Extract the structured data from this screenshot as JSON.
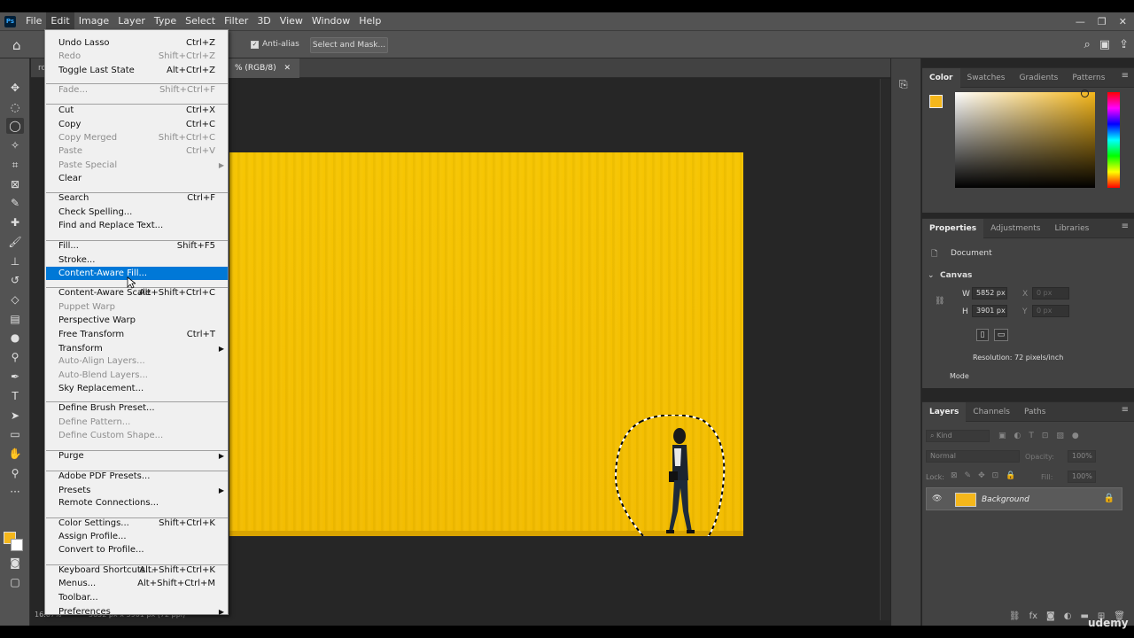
{
  "menubar": {
    "logo": "Ps",
    "items": [
      "File",
      "Edit",
      "Image",
      "Layer",
      "Type",
      "Select",
      "Filter",
      "3D",
      "View",
      "Window",
      "Help"
    ],
    "active": "Edit"
  },
  "optbar": {
    "anti_alias": "Anti-alias",
    "select_mask": "Select and Mask..."
  },
  "doc": {
    "tab_left": "ro",
    "tab_title": "% (RGB/8)",
    "zoom": "16.67%",
    "size": "5852 px x 3901 px (72 ppi)"
  },
  "edit_menu": [
    {
      "label": "Undo Lasso",
      "shortcut": "Ctrl+Z",
      "disabled": false
    },
    {
      "label": "Redo",
      "shortcut": "Shift+Ctrl+Z",
      "disabled": true
    },
    {
      "label": "Toggle Last State",
      "shortcut": "Alt+Ctrl+Z",
      "disabled": false
    },
    {
      "label": "Fade...",
      "shortcut": "Shift+Ctrl+F",
      "disabled": true
    },
    {
      "label": "Cut",
      "shortcut": "Ctrl+X",
      "disabled": false
    },
    {
      "label": "Copy",
      "shortcut": "Ctrl+C",
      "disabled": false
    },
    {
      "label": "Copy Merged",
      "shortcut": "Shift+Ctrl+C",
      "disabled": true
    },
    {
      "label": "Paste",
      "shortcut": "Ctrl+V",
      "disabled": true
    },
    {
      "label": "Paste Special",
      "shortcut": "",
      "disabled": true,
      "submenu": true
    },
    {
      "label": "Clear",
      "shortcut": "",
      "disabled": false
    },
    {
      "label": "Search",
      "shortcut": "Ctrl+F",
      "disabled": false
    },
    {
      "label": "Check Spelling...",
      "shortcut": "",
      "disabled": false
    },
    {
      "label": "Find and Replace Text...",
      "shortcut": "",
      "disabled": false
    },
    {
      "label": "Fill...",
      "shortcut": "Shift+F5",
      "disabled": false
    },
    {
      "label": "Stroke...",
      "shortcut": "",
      "disabled": false
    },
    {
      "label": "Content-Aware Fill...",
      "shortcut": "",
      "disabled": false,
      "highlighted": true
    },
    {
      "label": "Content-Aware Scale",
      "shortcut": "Alt+Shift+Ctrl+C",
      "disabled": false
    },
    {
      "label": "Puppet Warp",
      "shortcut": "",
      "disabled": true
    },
    {
      "label": "Perspective Warp",
      "shortcut": "",
      "disabled": false
    },
    {
      "label": "Free Transform",
      "shortcut": "Ctrl+T",
      "disabled": false
    },
    {
      "label": "Transform",
      "shortcut": "",
      "disabled": false,
      "submenu": true
    },
    {
      "label": "Auto-Align Layers...",
      "shortcut": "",
      "disabled": true
    },
    {
      "label": "Auto-Blend Layers...",
      "shortcut": "",
      "disabled": true
    },
    {
      "label": "Sky Replacement...",
      "shortcut": "",
      "disabled": false
    },
    {
      "label": "Define Brush Preset...",
      "shortcut": "",
      "disabled": false
    },
    {
      "label": "Define Pattern...",
      "shortcut": "",
      "disabled": true
    },
    {
      "label": "Define Custom Shape...",
      "shortcut": "",
      "disabled": true
    },
    {
      "label": "Purge",
      "shortcut": "",
      "disabled": false,
      "submenu": true
    },
    {
      "label": "Adobe PDF Presets...",
      "shortcut": "",
      "disabled": false
    },
    {
      "label": "Presets",
      "shortcut": "",
      "disabled": false,
      "submenu": true
    },
    {
      "label": "Remote Connections...",
      "shortcut": "",
      "disabled": false
    },
    {
      "label": "Color Settings...",
      "shortcut": "Shift+Ctrl+K",
      "disabled": false
    },
    {
      "label": "Assign Profile...",
      "shortcut": "",
      "disabled": false
    },
    {
      "label": "Convert to Profile...",
      "shortcut": "",
      "disabled": false
    },
    {
      "label": "Keyboard Shortcuts...",
      "shortcut": "Alt+Shift+Ctrl+K",
      "disabled": false
    },
    {
      "label": "Menus...",
      "shortcut": "Alt+Shift+Ctrl+M",
      "disabled": false
    },
    {
      "label": "Toolbar...",
      "shortcut": "",
      "disabled": false
    },
    {
      "label": "Preferences",
      "shortcut": "",
      "disabled": false,
      "submenu": true
    }
  ],
  "color_panel": {
    "tabs": [
      "Color",
      "Swatches",
      "Gradients",
      "Patterns"
    ],
    "active": "Color",
    "foreground": "#f5b71b"
  },
  "properties_panel": {
    "tabs": [
      "Properties",
      "Adjustments",
      "Libraries"
    ],
    "active": "Properties",
    "document_label": "Document",
    "canvas_label": "Canvas",
    "w_label": "W",
    "w_value": "5852 px",
    "h_label": "H",
    "h_value": "3901 px",
    "x_label": "X",
    "x_value": "0 px",
    "y_label": "Y",
    "y_value": "0 px",
    "resolution": "Resolution: 72 pixels/inch",
    "mode_label": "Mode"
  },
  "layers_panel": {
    "tabs": [
      "Layers",
      "Channels",
      "Paths"
    ],
    "active": "Layers",
    "kind": "Kind",
    "blend": "Normal",
    "opacity_label": "Opacity:",
    "opacity_value": "100%",
    "lock_label": "Lock:",
    "fill_label": "Fill:",
    "fill_value": "100%",
    "layer_name": "Background"
  },
  "watermark": "udemy"
}
